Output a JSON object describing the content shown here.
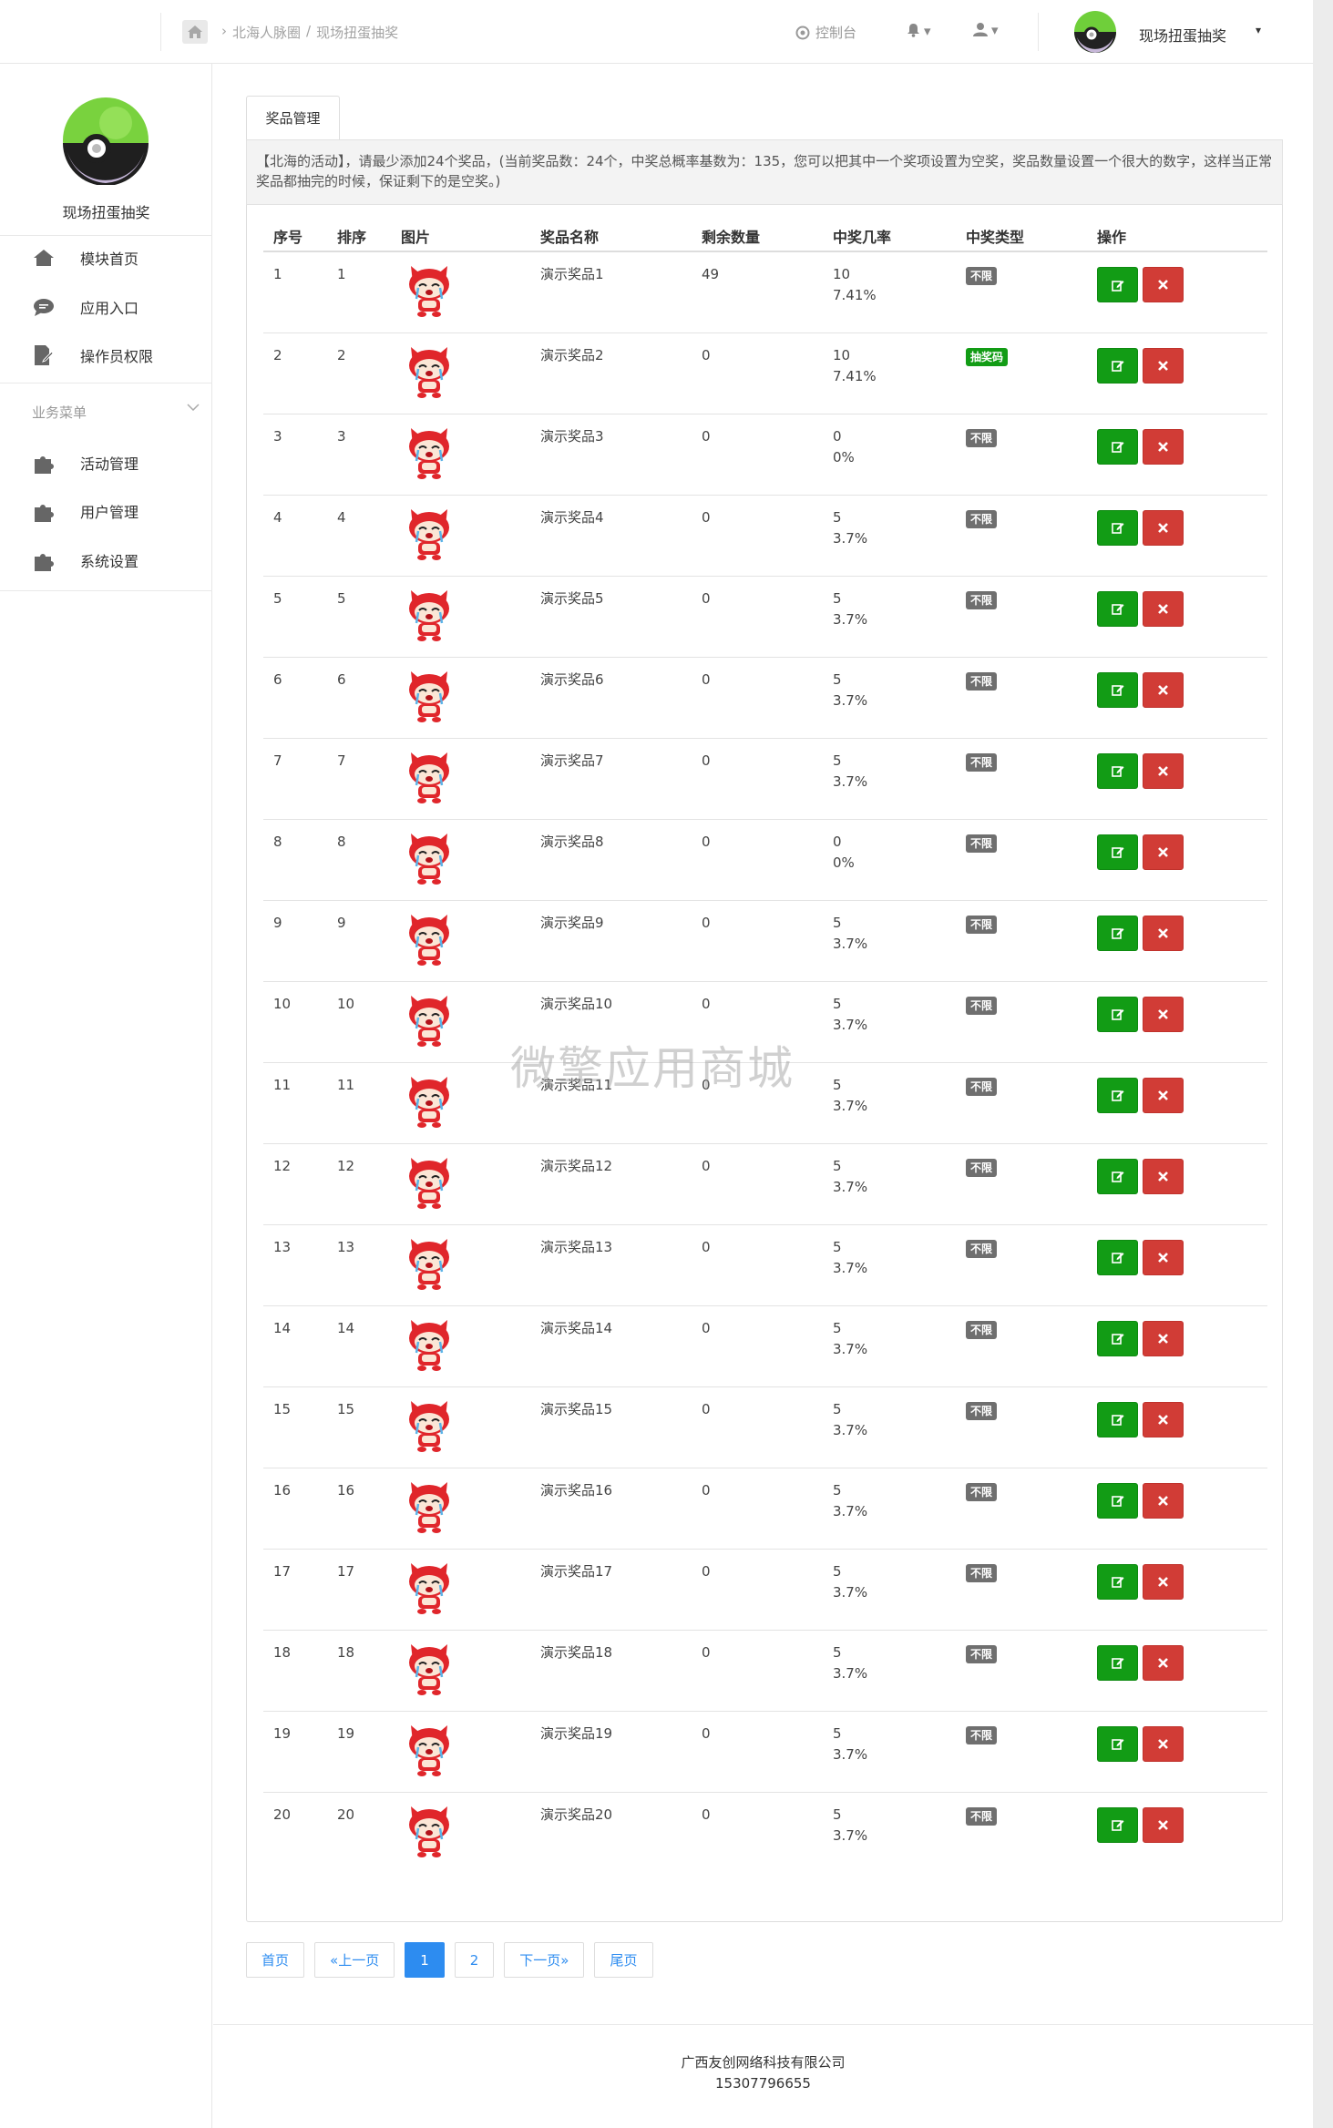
{
  "header": {
    "breadcrumb": [
      "北海人脉圈",
      "现场扭蛋抽奖"
    ],
    "breadcrumb_sep": "/",
    "console_label": "控制台",
    "user_name": "现场扭蛋抽奖",
    "caret": "▾"
  },
  "sidebar": {
    "app_name": "现场扭蛋抽奖",
    "top_items": [
      {
        "label": "模块首页",
        "icon": "home-icon"
      },
      {
        "label": "应用入口",
        "icon": "chat-icon"
      },
      {
        "label": "操作员权限",
        "icon": "document-edit-icon"
      }
    ],
    "section_label": "业务菜单",
    "section_items": [
      {
        "label": "活动管理",
        "icon": "puzzle-icon"
      },
      {
        "label": "用户管理",
        "icon": "puzzle-icon"
      },
      {
        "label": "系统设置",
        "icon": "puzzle-icon"
      }
    ]
  },
  "main": {
    "tab_label": "奖品管理",
    "notice": "【北海的活动】，请最少添加24个奖品，(当前奖品数：24个，中奖总概率基数为：135，您可以把其中一个奖项设置为空奖，奖品数量设置一个很大的数字，这样当正常奖品都抽完的时候，保证剩下的是空奖。)",
    "columns": [
      "序号",
      "排序",
      "图片",
      "奖品名称",
      "剩余数量",
      "中奖几率",
      "中奖类型",
      "操作"
    ],
    "rows": [
      {
        "no": "1",
        "sort": "1",
        "name": "演示奖品1",
        "qty": "49",
        "weight": "10",
        "rate": "7.41%",
        "type": "不限"
      },
      {
        "no": "2",
        "sort": "2",
        "name": "演示奖品2",
        "qty": "0",
        "weight": "10",
        "rate": "7.41%",
        "type": "抽奖码"
      },
      {
        "no": "3",
        "sort": "3",
        "name": "演示奖品3",
        "qty": "0",
        "weight": "0",
        "rate": "0%",
        "type": "不限"
      },
      {
        "no": "4",
        "sort": "4",
        "name": "演示奖品4",
        "qty": "0",
        "weight": "5",
        "rate": "3.7%",
        "type": "不限"
      },
      {
        "no": "5",
        "sort": "5",
        "name": "演示奖品5",
        "qty": "0",
        "weight": "5",
        "rate": "3.7%",
        "type": "不限"
      },
      {
        "no": "6",
        "sort": "6",
        "name": "演示奖品6",
        "qty": "0",
        "weight": "5",
        "rate": "3.7%",
        "type": "不限"
      },
      {
        "no": "7",
        "sort": "7",
        "name": "演示奖品7",
        "qty": "0",
        "weight": "5",
        "rate": "3.7%",
        "type": "不限"
      },
      {
        "no": "8",
        "sort": "8",
        "name": "演示奖品8",
        "qty": "0",
        "weight": "0",
        "rate": "0%",
        "type": "不限"
      },
      {
        "no": "9",
        "sort": "9",
        "name": "演示奖品9",
        "qty": "0",
        "weight": "5",
        "rate": "3.7%",
        "type": "不限"
      },
      {
        "no": "10",
        "sort": "10",
        "name": "演示奖品10",
        "qty": "0",
        "weight": "5",
        "rate": "3.7%",
        "type": "不限"
      },
      {
        "no": "11",
        "sort": "11",
        "name": "演示奖品11",
        "qty": "0",
        "weight": "5",
        "rate": "3.7%",
        "type": "不限"
      },
      {
        "no": "12",
        "sort": "12",
        "name": "演示奖品12",
        "qty": "0",
        "weight": "5",
        "rate": "3.7%",
        "type": "不限"
      },
      {
        "no": "13",
        "sort": "13",
        "name": "演示奖品13",
        "qty": "0",
        "weight": "5",
        "rate": "3.7%",
        "type": "不限"
      },
      {
        "no": "14",
        "sort": "14",
        "name": "演示奖品14",
        "qty": "0",
        "weight": "5",
        "rate": "3.7%",
        "type": "不限"
      },
      {
        "no": "15",
        "sort": "15",
        "name": "演示奖品15",
        "qty": "0",
        "weight": "5",
        "rate": "3.7%",
        "type": "不限"
      },
      {
        "no": "16",
        "sort": "16",
        "name": "演示奖品16",
        "qty": "0",
        "weight": "5",
        "rate": "3.7%",
        "type": "不限"
      },
      {
        "no": "17",
        "sort": "17",
        "name": "演示奖品17",
        "qty": "0",
        "weight": "5",
        "rate": "3.7%",
        "type": "不限"
      },
      {
        "no": "18",
        "sort": "18",
        "name": "演示奖品18",
        "qty": "0",
        "weight": "5",
        "rate": "3.7%",
        "type": "不限"
      },
      {
        "no": "19",
        "sort": "19",
        "name": "演示奖品19",
        "qty": "0",
        "weight": "5",
        "rate": "3.7%",
        "type": "不限"
      },
      {
        "no": "20",
        "sort": "20",
        "name": "演示奖品20",
        "qty": "0",
        "weight": "5",
        "rate": "3.7%",
        "type": "不限"
      }
    ]
  },
  "pagination": {
    "first": "首页",
    "prev": "«上一页",
    "pages": [
      "1",
      "2"
    ],
    "current": "1",
    "next": "下一页»",
    "last": "尾页"
  },
  "footer": {
    "company": "广西友创网络科技有限公司",
    "phone": "15307796655"
  },
  "watermark": "微擎应用商城",
  "colors": {
    "green": "#129c15",
    "red": "#d13c36",
    "gray_badge": "#6f6f6f",
    "link_blue": "#2d8cf0"
  }
}
